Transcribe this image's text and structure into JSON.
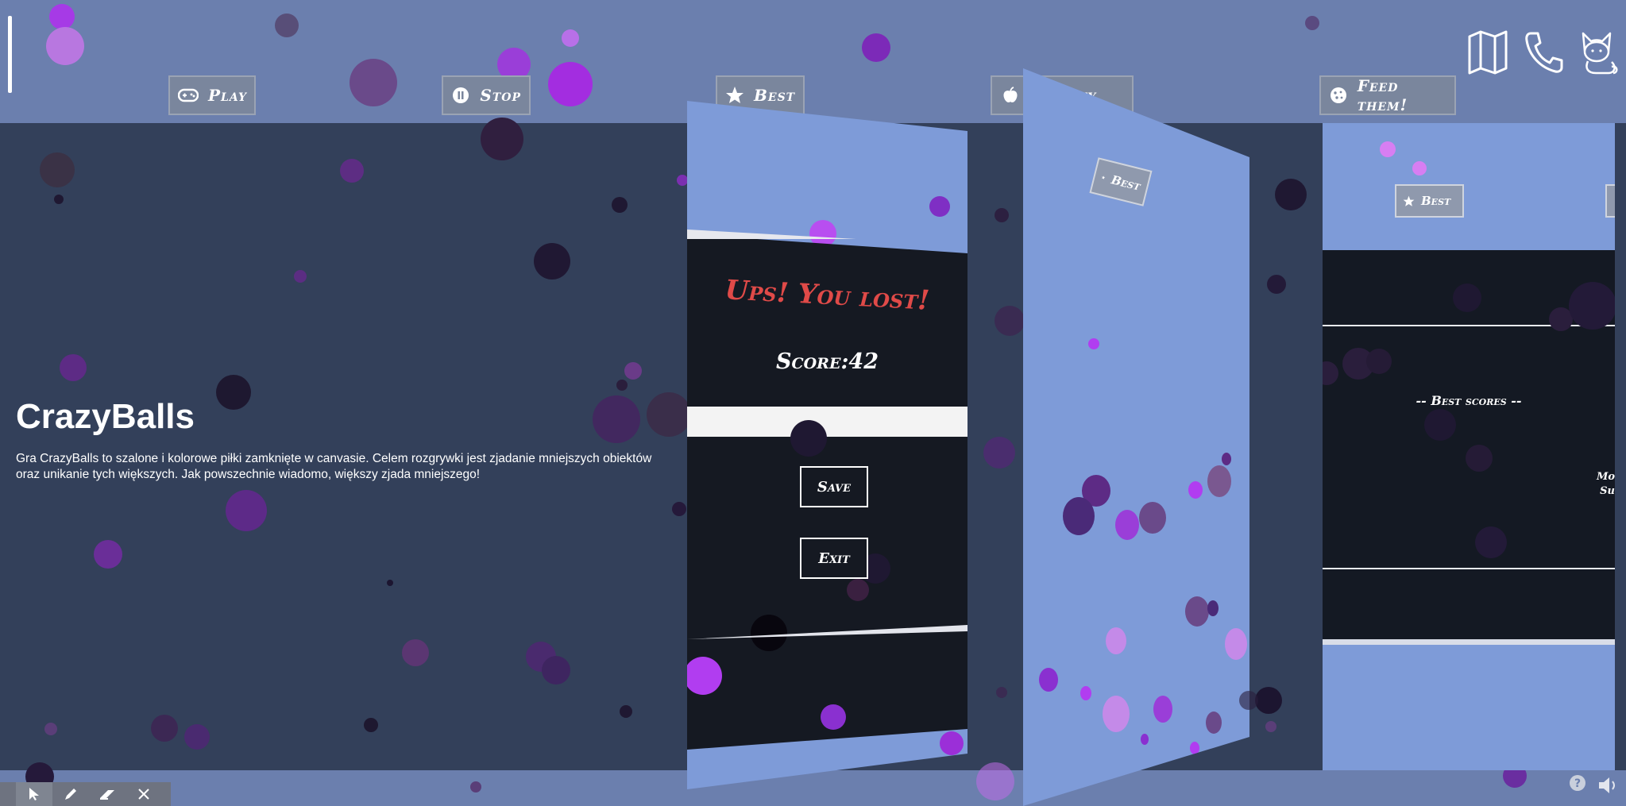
{
  "nav": {
    "play": "Play",
    "stop": "Stop",
    "best": "Best",
    "gravity": "Gravity",
    "feed": "Feed them!"
  },
  "top_icons": [
    "map-icon",
    "phone-icon",
    "cat-icon"
  ],
  "intro": {
    "title": "CrazyBalls",
    "description": "Gra CrazyBalls to szalone i kolorowe piłki zamknięte w canvasie. Celem rozgrywki jest zjadanie mniejszych obiektów oraz unikanie tych większych. Jak powszechnie wiadomo, większy zjada mniejszego!"
  },
  "game_over": {
    "title": "Ups! You lost!",
    "score_label": "Score:",
    "score_value": "42",
    "name_input_value": "",
    "save": "Save",
    "exit": "Exit"
  },
  "card2": {
    "best_button": "Best"
  },
  "card3": {
    "best_button": "Best",
    "best_scores_title": "-- Best scores --",
    "side_text_1": "Mo",
    "side_text_2": "Su"
  },
  "toolbar": [
    "pointer-icon",
    "pencil-icon",
    "eraser-icon",
    "close-icon"
  ],
  "colors": {
    "background": "#6b7fae",
    "panel": "#33405a",
    "card": "#7e9bd8",
    "game_over_bg": "#151922",
    "lost_title": "#e04a48",
    "ball_light": "#b13df0",
    "ball_dark": "#2a1740"
  }
}
